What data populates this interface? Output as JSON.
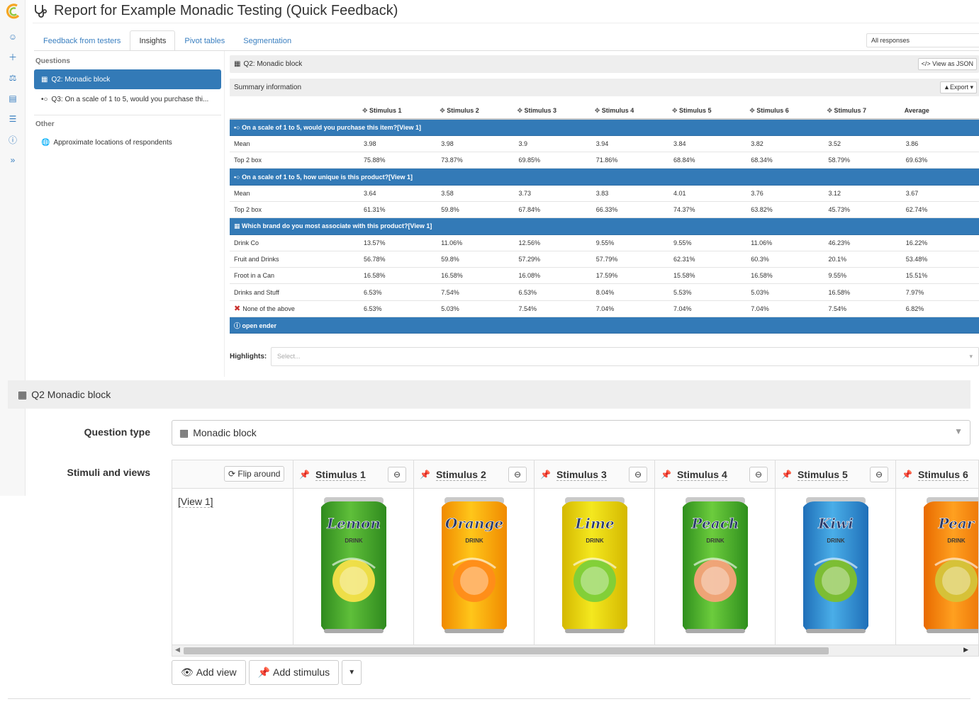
{
  "colors": {
    "accent": "#337ab7",
    "link": "#3a7fc0",
    "panel": "#eeeeee"
  },
  "header": {
    "title": "Report for Example Monadic Testing (Quick Feedback)",
    "icon": "stethoscope-icon"
  },
  "rail": {
    "icons": [
      "user-icon",
      "plus-icon",
      "flask-icon",
      "document-icon",
      "list-icon",
      "help-icon",
      "expand-icon"
    ]
  },
  "tabs": [
    "Feedback from testers",
    "Insights",
    "Pivot tables",
    "Segmentation"
  ],
  "active_tab": 1,
  "filter": {
    "value": "All responses"
  },
  "sidebar": {
    "questions_label": "Questions",
    "questions": [
      {
        "label": "Q2: Monadic block",
        "active": true
      },
      {
        "label": "Q3: On a scale of 1 to 5, would you purchase thi..."
      }
    ],
    "other_label": "Other",
    "other": [
      {
        "label": "Approximate locations of respondents"
      }
    ]
  },
  "panel": {
    "title": "Q2: Monadic block",
    "json_button": "View as JSON",
    "summary_label": "Summary information",
    "export_button": "Export"
  },
  "table": {
    "columns": [
      "Stimulus 1",
      "Stimulus 2",
      "Stimulus 3",
      "Stimulus 4",
      "Stimulus 5",
      "Stimulus 6",
      "Stimulus 7",
      "Average"
    ],
    "groups": [
      {
        "title": "On a scale of 1 to 5, would you purchase this item?[View 1]",
        "rows": [
          {
            "label": "Mean",
            "values": [
              "3.98",
              "3.98",
              "3.9",
              "3.94",
              "3.84",
              "3.82",
              "3.52",
              "3.86"
            ]
          },
          {
            "label": "Top 2 box",
            "values": [
              "75.88%",
              "73.87%",
              "69.85%",
              "71.86%",
              "68.84%",
              "68.34%",
              "58.79%",
              "69.63%"
            ]
          }
        ]
      },
      {
        "title": "On a scale of 1 to 5, how unique is this product?[View 1]",
        "rows": [
          {
            "label": "Mean",
            "values": [
              "3.64",
              "3.58",
              "3.73",
              "3.83",
              "4.01",
              "3.76",
              "3.12",
              "3.67"
            ]
          },
          {
            "label": "Top 2 box",
            "values": [
              "61.31%",
              "59.8%",
              "67.84%",
              "66.33%",
              "74.37%",
              "63.82%",
              "45.73%",
              "62.74%"
            ]
          }
        ]
      },
      {
        "title": "Which brand do you most associate with this product?[View 1]",
        "rows": [
          {
            "label": "Drink Co",
            "values": [
              "13.57%",
              "11.06%",
              "12.56%",
              "9.55%",
              "9.55%",
              "11.06%",
              "46.23%",
              "16.22%"
            ]
          },
          {
            "label": "Fruit and Drinks",
            "values": [
              "56.78%",
              "59.8%",
              "57.29%",
              "57.79%",
              "62.31%",
              "60.3%",
              "20.1%",
              "53.48%"
            ]
          },
          {
            "label": "Froot in a Can",
            "values": [
              "16.58%",
              "16.58%",
              "16.08%",
              "17.59%",
              "15.58%",
              "16.58%",
              "9.55%",
              "15.51%"
            ]
          },
          {
            "label": "Drinks and Stuff",
            "values": [
              "6.53%",
              "7.54%",
              "6.53%",
              "8.04%",
              "5.53%",
              "5.03%",
              "16.58%",
              "7.97%"
            ]
          },
          {
            "label": "None of the above",
            "values": [
              "6.53%",
              "5.03%",
              "7.54%",
              "7.04%",
              "7.04%",
              "7.04%",
              "7.54%",
              "6.82%"
            ],
            "icon": "x-icon"
          }
        ]
      },
      {
        "title": "open ender",
        "rows": []
      }
    ]
  },
  "highlights": {
    "label": "Highlights:",
    "placeholder": "Select..."
  },
  "editor": {
    "title": "Q2 Monadic block",
    "question_type_label": "Question type",
    "question_type_value": "Monadic block",
    "stimuli_label": "Stimuli and views",
    "flip_button": "Flip around",
    "stimuli": [
      {
        "name": "Stimulus 1",
        "flavor": "Lemon",
        "c1": "#5fbf3a",
        "c2": "#2f8a1e",
        "fruit": "#f7e04a"
      },
      {
        "name": "Stimulus 2",
        "flavor": "Orange",
        "c1": "#ffc61a",
        "c2": "#f08a00",
        "fruit": "#ff8c1a"
      },
      {
        "name": "Stimulus 3",
        "flavor": "Lime",
        "c1": "#f4e81f",
        "c2": "#d4b800",
        "fruit": "#7ccf3a"
      },
      {
        "name": "Stimulus 4",
        "flavor": "Peach",
        "c1": "#6ccc3d",
        "c2": "#2f8f1d",
        "fruit": "#f7a27a"
      },
      {
        "name": "Stimulus 5",
        "flavor": "Kiwi",
        "c1": "#4aaee8",
        "c2": "#1f6fb8",
        "fruit": "#7fbf2a"
      },
      {
        "name": "Stimulus 6",
        "flavor": "Pear",
        "c1": "#ffa020",
        "c2": "#e86a00",
        "fruit": "#d4c43a"
      }
    ],
    "can_sub": "DRINK",
    "view_label": "[View 1]",
    "add_view_button": "Add view",
    "add_stimulus_button": "Add stimulus"
  }
}
